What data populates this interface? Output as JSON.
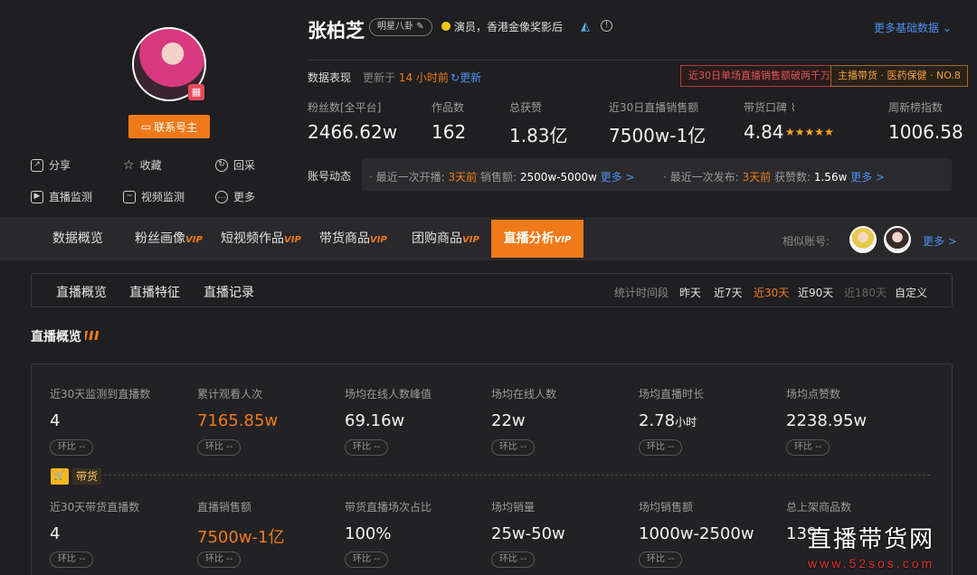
{
  "profile": {
    "name": "张柏芝",
    "category_tag": "明星八卦",
    "description": "演员，香港金像奖影后",
    "contact_button": "联系号主",
    "more_data": "更多基础数据",
    "actions": [
      {
        "label": "分享",
        "icon": "share-icon"
      },
      {
        "label": "收藏",
        "icon": "star-icon"
      },
      {
        "label": "回采",
        "icon": "refresh-icon"
      },
      {
        "label": "直播监测",
        "icon": "live-monitor-icon"
      },
      {
        "label": "视频监测",
        "icon": "video-monitor-icon"
      },
      {
        "label": "更多",
        "icon": "more-icon"
      }
    ]
  },
  "data_header": {
    "title": "数据表现",
    "updated_prefix": "更新于",
    "updated_time": "14 小时前",
    "refresh": "更新",
    "badge_red": "近30日单场直播销售额破两千万",
    "badge_orange": "主播带货 · 医药保健 · NO.8"
  },
  "stats": [
    {
      "label": "粉丝数[全平台]",
      "value": "2466.62w"
    },
    {
      "label": "作品数",
      "value": "162"
    },
    {
      "label": "总获赞",
      "value": "1.83亿"
    },
    {
      "label": "近30日直播销售额",
      "value": "7500w-1亿"
    },
    {
      "label": "带货口碑",
      "value": "4.84"
    },
    {
      "label": "周新榜指数",
      "value": "1006.58"
    }
  ],
  "stars": "★★★★★",
  "account": {
    "label": "账号动态",
    "live_prefix": "· 最近一次开播:",
    "live_time": "3天前",
    "sales_label": "销售额:",
    "sales_value": "2500w-5000w",
    "more1": "更多 >",
    "post_prefix": "· 最近一次发布:",
    "post_time": "3天前",
    "likes_label": "获赞数:",
    "likes_value": "1.56w",
    "more2": "更多 >"
  },
  "tabs": [
    {
      "label": "数据概览",
      "vip": ""
    },
    {
      "label": "粉丝画像",
      "vip": "VIP"
    },
    {
      "label": "短视频作品",
      "vip": "VIP"
    },
    {
      "label": "带货商品",
      "vip": "VIP"
    },
    {
      "label": "团购商品",
      "vip": "VIP"
    },
    {
      "label": "直播分析",
      "vip": "VIP"
    }
  ],
  "similar_label": "相似账号:",
  "similar_more": "更多 >",
  "subtabs": [
    "直播概览",
    "直播特征",
    "直播记录"
  ],
  "range_label": "统计时间段",
  "ranges": [
    "昨天",
    "近7天",
    "近30天",
    "近90天",
    "近180天",
    "自定义"
  ],
  "section_title": "直播概览",
  "row1": [
    {
      "label": "近30天监测到直播数",
      "value": "4",
      "unit": ""
    },
    {
      "label": "累计观看人次",
      "value": "7165.85w",
      "unit": ""
    },
    {
      "label": "场均在线人数峰值",
      "value": "69.16w",
      "unit": ""
    },
    {
      "label": "场均在线人数",
      "value": "22w",
      "unit": ""
    },
    {
      "label": "场均直播时长",
      "value": "2.78",
      "unit": "小时"
    },
    {
      "label": "场均点赞数",
      "value": "2238.95w",
      "unit": ""
    }
  ],
  "compare": "环比 --",
  "carry_label": "带货",
  "row2": [
    {
      "label": "近30天带货直播数",
      "value": "4"
    },
    {
      "label": "直播销售额",
      "value": "7500w-1亿"
    },
    {
      "label": "带货直播场次占比",
      "value": "100%"
    },
    {
      "label": "场均销量",
      "value": "25w-50w"
    },
    {
      "label": "场均销售额",
      "value": "1000w-2500w"
    },
    {
      "label": "总上架商品数",
      "value": "139"
    }
  ],
  "watermark": {
    "title": "直播带货网",
    "url": "www.52sos.com"
  },
  "colors": {
    "accent": "#f07a1a",
    "link": "#4d8ff0",
    "background": "#1f1f21"
  }
}
